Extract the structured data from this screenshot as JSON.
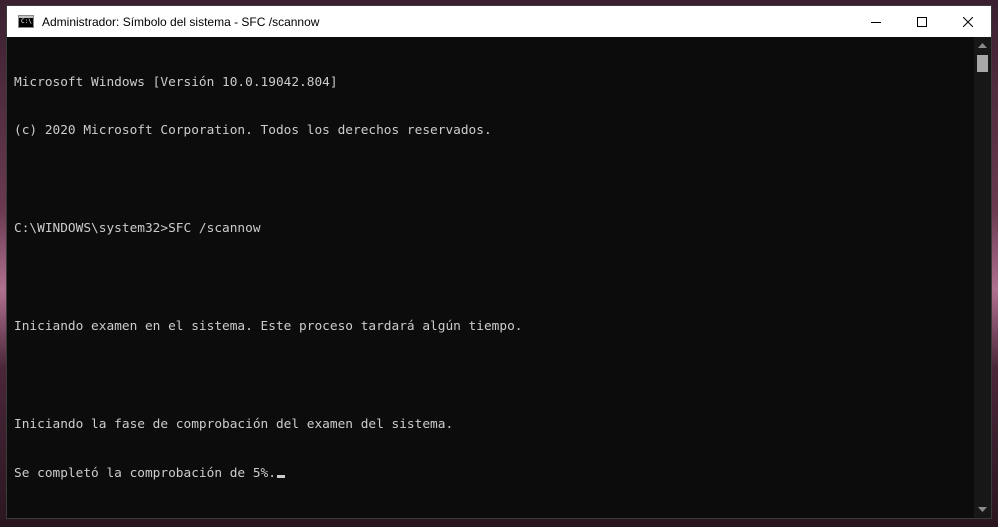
{
  "window": {
    "title": "Administrador: Símbolo del sistema - SFC  /scannow",
    "icon": "cmd-icon",
    "icon_text": "C:\\",
    "controls": [
      "minimize-icon",
      "maximize-icon",
      "close-icon"
    ]
  },
  "console": {
    "lines": [
      "Microsoft Windows [Versión 10.0.19042.804]",
      "(c) 2020 Microsoft Corporation. Todos los derechos reservados.",
      "",
      "C:\\WINDOWS\\system32>SFC /scannow",
      "",
      "Iniciando examen en el sistema. Este proceso tardará algún tiempo.",
      "",
      "Iniciando la fase de comprobación del examen del sistema.",
      "Se completó la comprobación de 5%."
    ],
    "text_color": "#cccccc",
    "background_color": "#0c0c0c"
  },
  "scrollbar": {
    "icons": [
      "scroll-up-arrow-icon",
      "scroll-down-arrow-icon"
    ]
  }
}
